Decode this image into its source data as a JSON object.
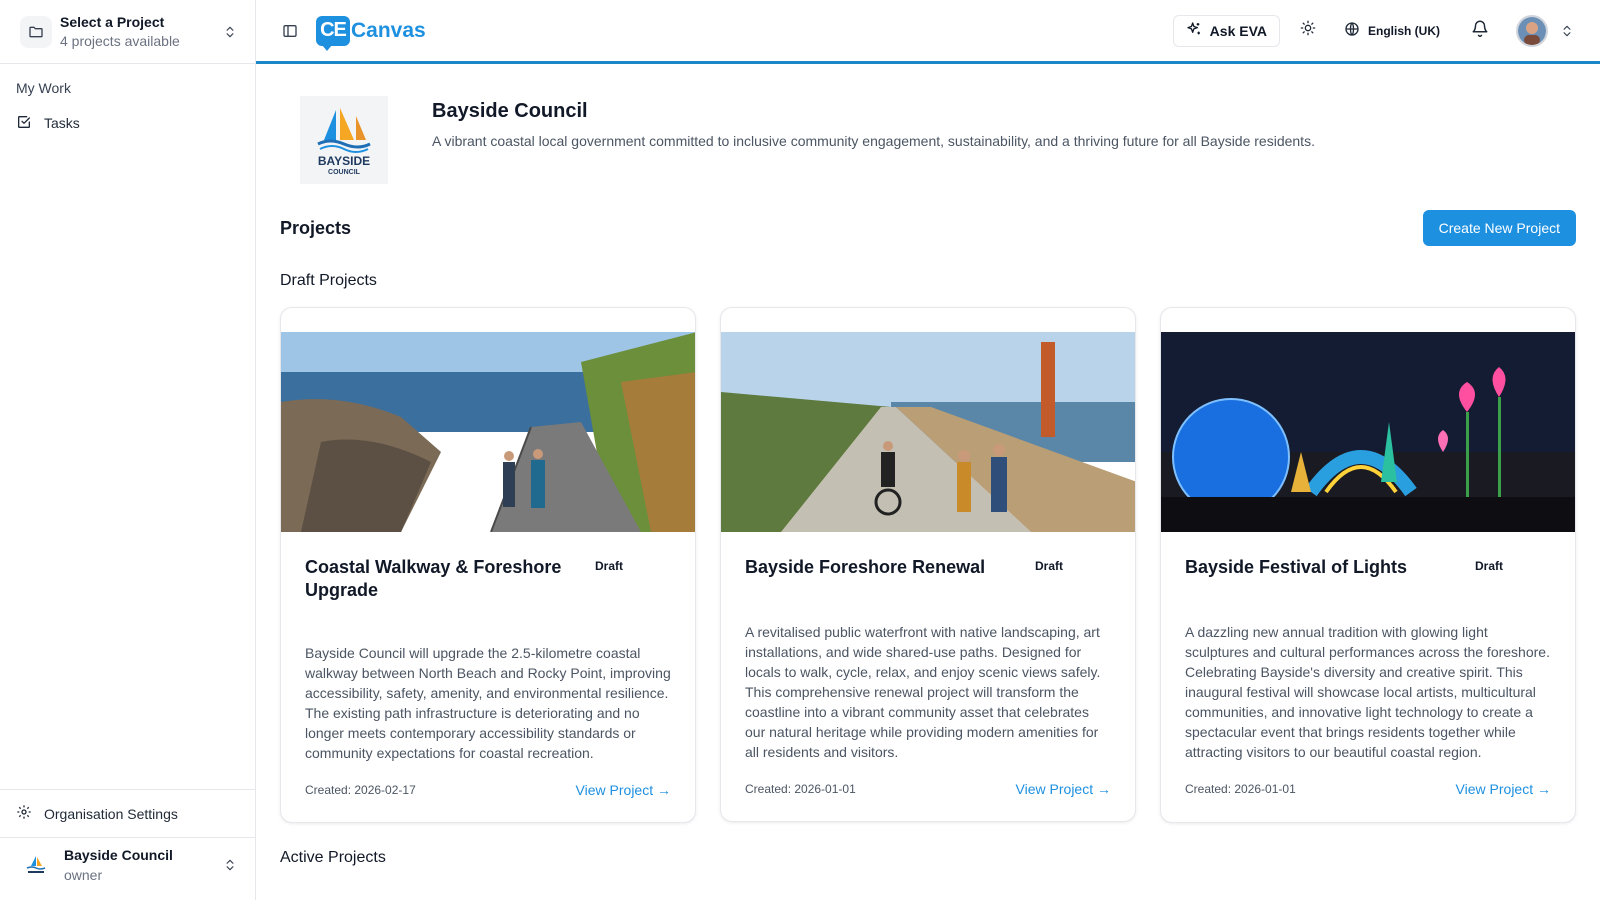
{
  "project_selector": {
    "title": "Select a Project",
    "subtitle": "4 projects available"
  },
  "sidebar": {
    "section_heading": "My Work",
    "items": [
      {
        "label": "Tasks",
        "icon": "check-square-icon"
      }
    ],
    "settings_label": "Organisation Settings",
    "org": {
      "name": "Bayside Council",
      "role": "owner"
    }
  },
  "header": {
    "brand_mark": "CE",
    "brand_name": "Canvas",
    "ask_eva": "Ask EVA",
    "language": "English (UK)",
    "accent": "#1e90e0"
  },
  "org": {
    "name": "Bayside Council",
    "description": "A vibrant coastal local government committed to inclusive community engagement, sustainability, and a thriving future for all Bayside residents.",
    "logo_text_1": "BAYSIDE",
    "logo_text_2": "COUNCIL"
  },
  "projects": {
    "title": "Projects",
    "create_label": "Create New Project",
    "draft_title": "Draft Projects",
    "active_title": "Active Projects",
    "cards": [
      {
        "title": "Coastal Walkway & Foreshore Upgrade",
        "status": "Draft",
        "description": "Bayside Council will upgrade the 2.5-kilometre coastal walkway between North Beach and Rocky Point, improving accessibility, safety, amenity, and environmental resilience. The existing path infrastructure is deteriorating and no longer meets contemporary accessibility standards or community expectations for coastal recreation.",
        "created": "Created: 2026-02-17",
        "link": "View Project →"
      },
      {
        "title": "Bayside Foreshore Renewal",
        "status": "Draft",
        "description": "A revitalised public waterfront with native landscaping, art installations, and wide shared-use paths. Designed for locals to walk, cycle, relax, and enjoy scenic views safely. This comprehensive renewal project will transform the coastline into a vibrant community asset that celebrates our natural heritage while providing modern amenities for all residents and visitors.",
        "created": "Created: 2026-01-01",
        "link": "View Project →"
      },
      {
        "title": "Bayside Festival of Lights",
        "status": "Draft",
        "description": "A dazzling new annual tradition with glowing light sculptures and cultural performances across the foreshore. Celebrating Bayside's diversity and creative spirit. This inaugural festival will showcase local artists, multicultural communities, and innovative light technology to create a spectacular event that brings residents together while attracting visitors to our beautiful coastal region.",
        "created": "Created: 2026-01-01",
        "link": "View Project →"
      }
    ]
  }
}
